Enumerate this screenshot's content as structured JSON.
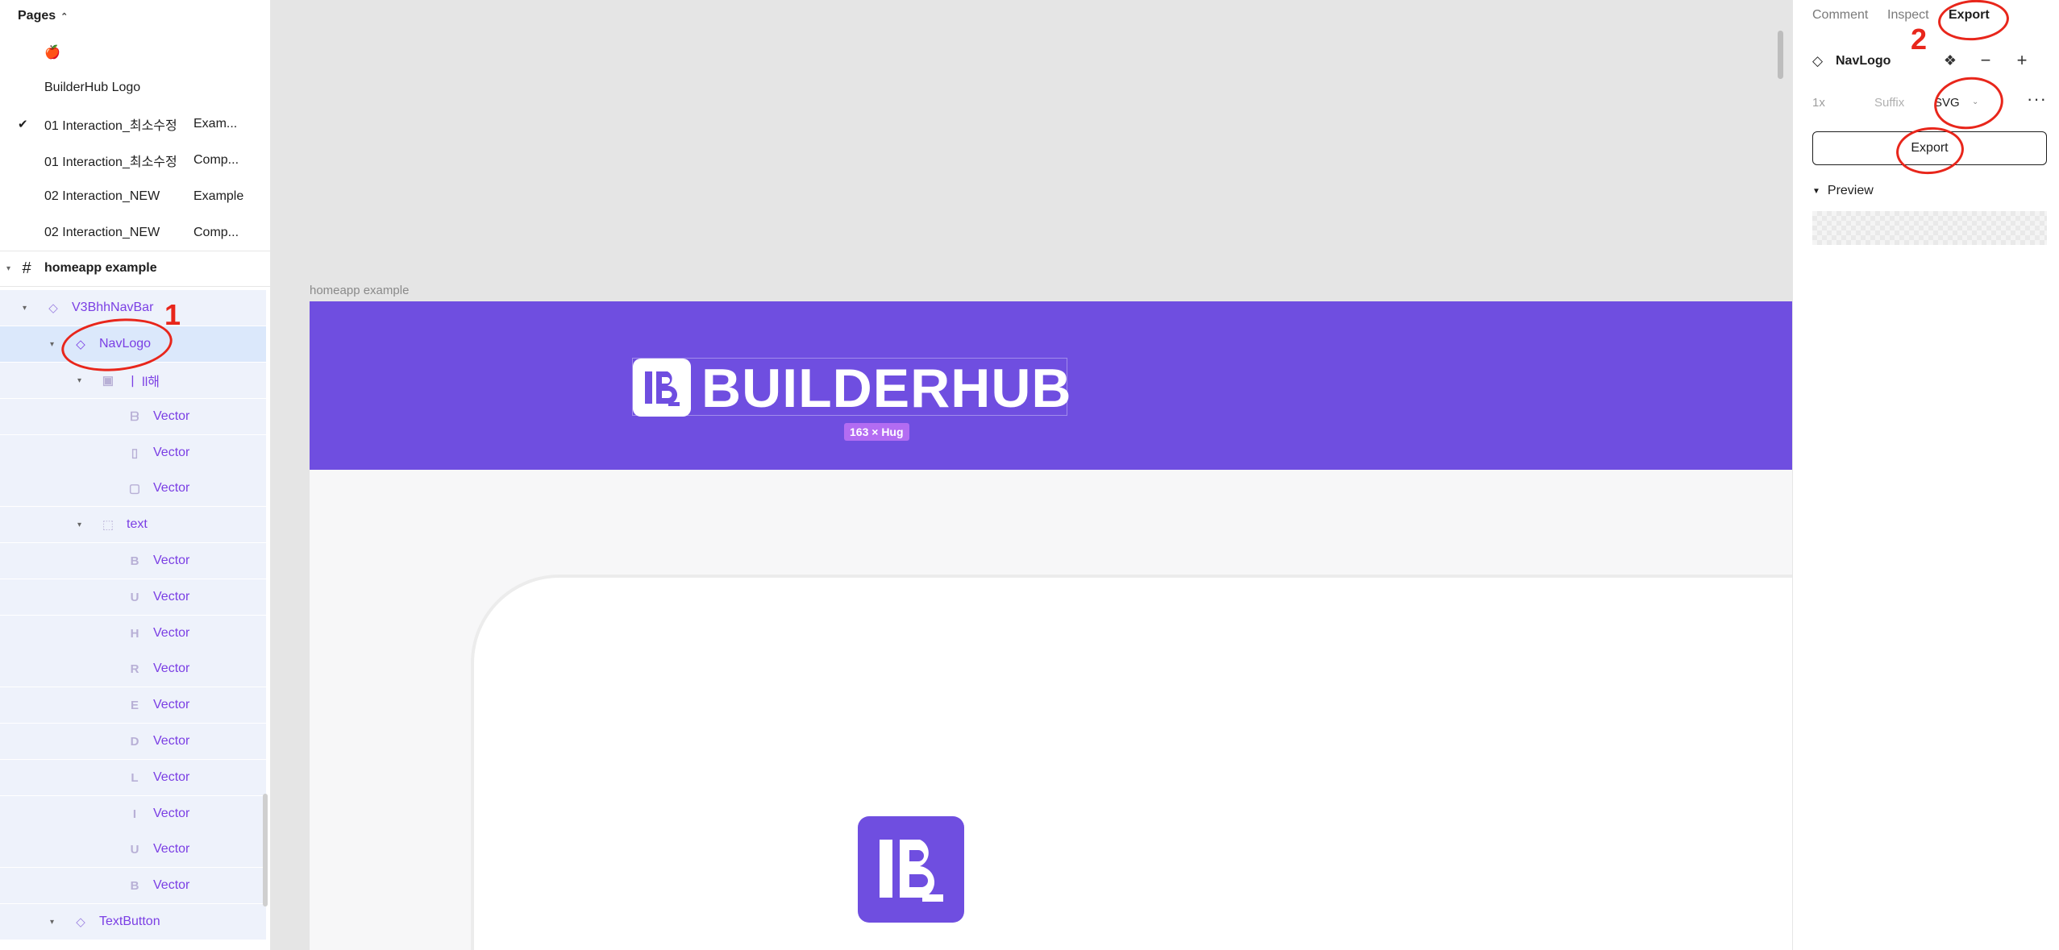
{
  "sidebar": {
    "pages_header": "Pages",
    "pages": [
      {
        "name": "🍎",
        "tag": "",
        "checked": false
      },
      {
        "name": "BuilderHub Logo",
        "tag": "",
        "checked": false
      },
      {
        "name": "01 Interaction_최소수정",
        "tag": "Exam...",
        "checked": true
      },
      {
        "name": "01 Interaction_최소수정",
        "tag": "Comp...",
        "checked": false
      },
      {
        "name": "02 Interaction_NEW",
        "tag": "Example",
        "checked": false
      },
      {
        "name": "02 Interaction_NEW",
        "tag": "Comp...",
        "checked": false
      }
    ],
    "check_glyph": "✔",
    "frame_name": "homeapp example",
    "layers": [
      {
        "name": "V3BhhNavBar",
        "icon": "component-icon"
      },
      {
        "name": "NavLogo",
        "icon": "component-icon"
      },
      {
        "name": "ㅣ ll해",
        "icon": "group-icon"
      },
      {
        "name": "Vector",
        "glyph": "ᗷ"
      },
      {
        "name": "Vector",
        "glyph": "▯"
      },
      {
        "name": "Vector",
        "glyph": "▢"
      },
      {
        "name": "text",
        "icon": "group-dashed-icon"
      },
      {
        "name": "Vector",
        "glyph": "B"
      },
      {
        "name": "Vector",
        "glyph": "U"
      },
      {
        "name": "Vector",
        "glyph": "H"
      },
      {
        "name": "Vector",
        "glyph": "R"
      },
      {
        "name": "Vector",
        "glyph": "E"
      },
      {
        "name": "Vector",
        "glyph": "D"
      },
      {
        "name": "Vector",
        "glyph": "L"
      },
      {
        "name": "Vector",
        "glyph": "I"
      },
      {
        "name": "Vector",
        "glyph": "U"
      },
      {
        "name": "Vector",
        "glyph": "B"
      },
      {
        "name": "TextButton",
        "icon": "component-icon"
      }
    ]
  },
  "canvas": {
    "frame_label": "homeapp example",
    "logo_text": "BUILDERHUB",
    "size_badge": "163 × Hug",
    "colors": {
      "brand": "#6f4ee0",
      "badge": "#b36cf2"
    }
  },
  "right_panel": {
    "tabs": [
      "Comment",
      "Inspect",
      "Export"
    ],
    "active_tab": "Export",
    "component_name": "NavLogo",
    "scale": "1x",
    "suffix_placeholder": "Suffix",
    "format": "SVG",
    "export_button": "Export",
    "preview_label": "Preview"
  },
  "annotations": {
    "step1": "1",
    "step2": "2",
    "color": "#e8261b"
  }
}
